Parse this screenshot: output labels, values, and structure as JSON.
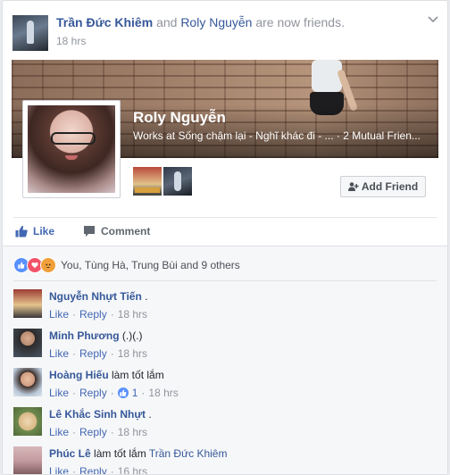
{
  "story": {
    "actor": "Trần Đức Khiêm",
    "connector": "and",
    "friend": "Roly Nguyễn",
    "suffix": "are now friends.",
    "time": "18 hrs"
  },
  "profile": {
    "name": "Roly Nguyễn",
    "work": "Works at Sống chậm lại - Nghĩ khác đi - ... · 2 Mutual Frien...",
    "add_friend_label": "Add Friend"
  },
  "actions": {
    "like_label": "Like",
    "comment_label": "Comment"
  },
  "reactions": {
    "summary": "You, Tùng Hà, Trung Bùi and 9 others",
    "types": [
      "like",
      "love",
      "angry"
    ]
  },
  "comments": [
    {
      "author": "Nguyễn Nhựt Tiến",
      "text": ".",
      "reply_to": "",
      "like": "Like",
      "reply": "Reply",
      "likes": "",
      "time": "18 hrs"
    },
    {
      "author": "Minh Phương",
      "text": "(.)(.)",
      "reply_to": "",
      "like": "Like",
      "reply": "Reply",
      "likes": "",
      "time": "18 hrs"
    },
    {
      "author": "Hoàng Hiếu",
      "text": "làm tốt lắm",
      "reply_to": "",
      "like": "Like",
      "reply": "Reply",
      "likes": "1",
      "time": "18 hrs"
    },
    {
      "author": "Lê Khắc Sinh Nhựt",
      "text": ".",
      "reply_to": "",
      "like": "Like",
      "reply": "Reply",
      "likes": "",
      "time": "18 hrs"
    },
    {
      "author": "Phúc Lê",
      "text": "làm tốt lắm",
      "reply_to": "Trần Đức Khiêm",
      "like": "Like",
      "reply": "Reply",
      "likes": "",
      "time": "16 hrs"
    }
  ],
  "colors": {
    "link": "#365899",
    "action_blue": "#4267b2",
    "meta_gray": "#90949c"
  }
}
